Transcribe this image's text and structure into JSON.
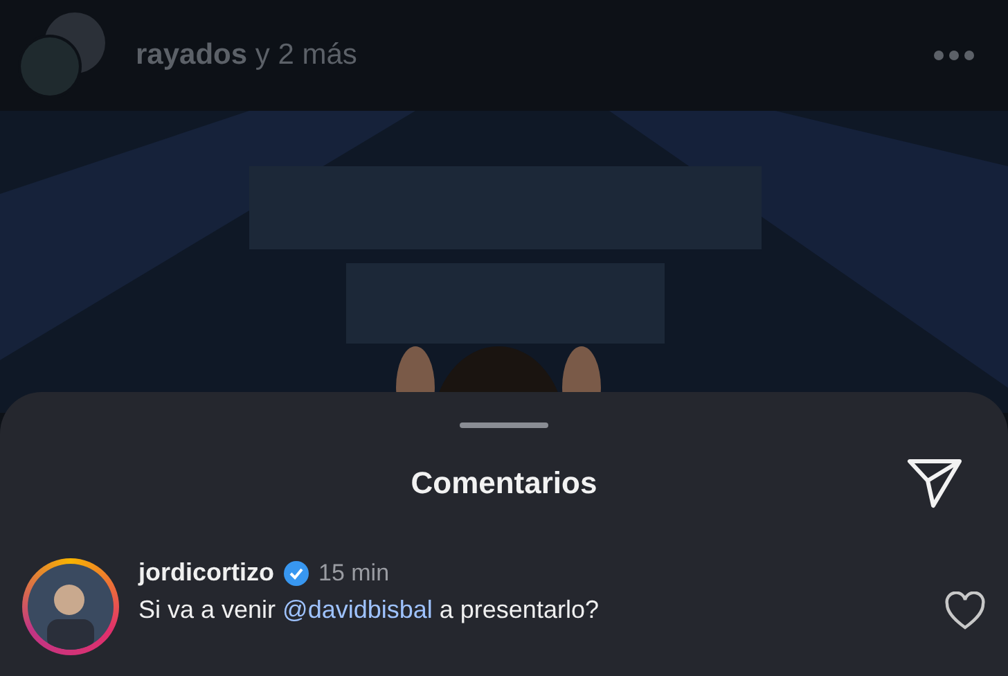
{
  "post": {
    "author": "rayados",
    "author_suffix": "y 2 más"
  },
  "sheet": {
    "title": "Comentarios"
  },
  "comments": [
    {
      "username": "jordicortizo",
      "verified": true,
      "time": "15 min",
      "text_before": "Si va a venir",
      "mention": "@davidbisbal",
      "text_after": "a presentarlo?",
      "liked": false
    }
  ]
}
